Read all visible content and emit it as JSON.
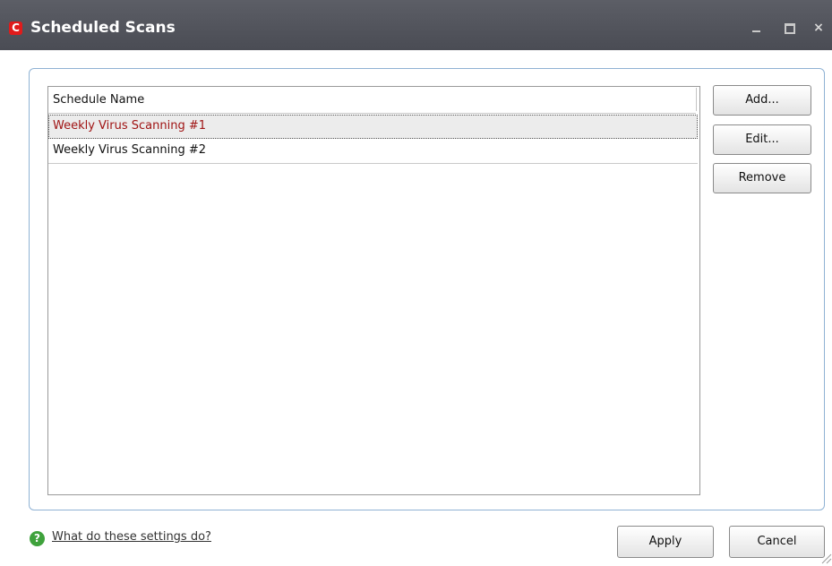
{
  "window": {
    "title": "Scheduled Scans",
    "logo_letter": "C",
    "controls": {
      "minimize": "minimize-icon",
      "maximize": "maximize-icon",
      "close": "×"
    }
  },
  "list": {
    "column_header": "Schedule Name",
    "rows": [
      {
        "name": "Weekly Virus Scanning #1",
        "selected": true
      },
      {
        "name": "Weekly Virus Scanning #2",
        "selected": false
      }
    ]
  },
  "side_buttons": {
    "add": "Add...",
    "edit": "Edit...",
    "remove": "Remove"
  },
  "footer": {
    "help_icon": "?",
    "help_link": "What do these settings do?",
    "apply": "Apply",
    "cancel": "Cancel"
  },
  "colors": {
    "titlebar": "#4f5159",
    "selected_row_text": "#a01414",
    "selected_row_bg": "#ececec",
    "panel_border": "#8fb2d4",
    "help_icon": "#3fa23c",
    "logo": "#e01b1b"
  }
}
